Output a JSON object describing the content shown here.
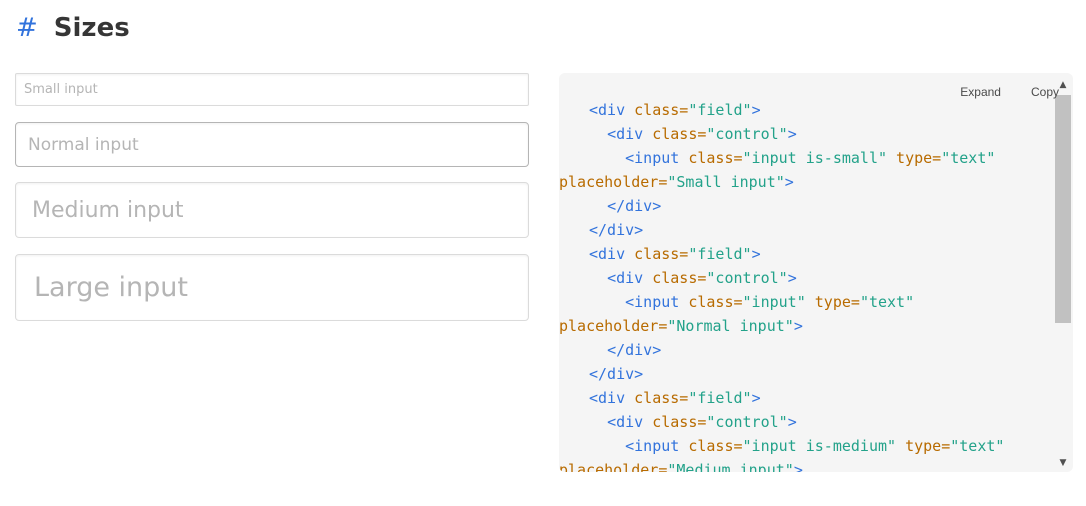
{
  "section": {
    "hash": "#",
    "title": "Sizes"
  },
  "inputs": {
    "small_placeholder": "Small input",
    "normal_placeholder": "Normal input",
    "medium_placeholder": "Medium input",
    "large_placeholder": "Large input"
  },
  "code_panel": {
    "expand_label": "Expand",
    "copy_label": "Copy",
    "lines": [
      {
        "indent": "",
        "parts": [
          [
            "tag",
            "<div "
          ],
          [
            "attr",
            "class="
          ],
          [
            "str",
            "\"field\""
          ],
          [
            "tag",
            ">"
          ]
        ]
      },
      {
        "indent": "  ",
        "parts": [
          [
            "tag",
            "<div "
          ],
          [
            "attr",
            "class="
          ],
          [
            "str",
            "\"control\""
          ],
          [
            "tag",
            ">"
          ]
        ]
      },
      {
        "indent": "    ",
        "parts": [
          [
            "tag",
            "<input "
          ],
          [
            "attr",
            "class="
          ],
          [
            "str",
            "\"input is-small\""
          ],
          [
            "attr",
            " type="
          ],
          [
            "str",
            "\"text\""
          ]
        ]
      },
      {
        "indent": "",
        "wrap": true,
        "parts": [
          [
            "attr",
            "placeholder="
          ],
          [
            "str",
            "\"Small input\""
          ],
          [
            "tag",
            ">"
          ]
        ]
      },
      {
        "indent": "  ",
        "parts": [
          [
            "tag",
            "</div>"
          ]
        ]
      },
      {
        "indent": "",
        "parts": [
          [
            "tag",
            "</div>"
          ]
        ]
      },
      {
        "indent": "",
        "parts": [
          [
            "tag",
            "<div "
          ],
          [
            "attr",
            "class="
          ],
          [
            "str",
            "\"field\""
          ],
          [
            "tag",
            ">"
          ]
        ]
      },
      {
        "indent": "  ",
        "parts": [
          [
            "tag",
            "<div "
          ],
          [
            "attr",
            "class="
          ],
          [
            "str",
            "\"control\""
          ],
          [
            "tag",
            ">"
          ]
        ]
      },
      {
        "indent": "    ",
        "parts": [
          [
            "tag",
            "<input "
          ],
          [
            "attr",
            "class="
          ],
          [
            "str",
            "\"input\""
          ],
          [
            "attr",
            " type="
          ],
          [
            "str",
            "\"text\""
          ]
        ]
      },
      {
        "indent": "",
        "wrap": true,
        "parts": [
          [
            "attr",
            "placeholder="
          ],
          [
            "str",
            "\"Normal input\""
          ],
          [
            "tag",
            ">"
          ]
        ]
      },
      {
        "indent": "  ",
        "parts": [
          [
            "tag",
            "</div>"
          ]
        ]
      },
      {
        "indent": "",
        "parts": [
          [
            "tag",
            "</div>"
          ]
        ]
      },
      {
        "indent": "",
        "parts": [
          [
            "tag",
            "<div "
          ],
          [
            "attr",
            "class="
          ],
          [
            "str",
            "\"field\""
          ],
          [
            "tag",
            ">"
          ]
        ]
      },
      {
        "indent": "  ",
        "parts": [
          [
            "tag",
            "<div "
          ],
          [
            "attr",
            "class="
          ],
          [
            "str",
            "\"control\""
          ],
          [
            "tag",
            ">"
          ]
        ]
      },
      {
        "indent": "    ",
        "parts": [
          [
            "tag",
            "<input "
          ],
          [
            "attr",
            "class="
          ],
          [
            "str",
            "\"input is-medium\""
          ],
          [
            "attr",
            " type="
          ],
          [
            "str",
            "\"text\""
          ]
        ]
      },
      {
        "indent": "",
        "wrap": true,
        "parts": [
          [
            "attr",
            "placeholder="
          ],
          [
            "str",
            "\"Medium input\""
          ],
          [
            "tag",
            ">"
          ]
        ]
      }
    ]
  },
  "icons": {
    "scroll_up": "scroll-up-arrow-icon",
    "scroll_down": "scroll-down-arrow-icon"
  },
  "colors": {
    "accent": "#3273dc",
    "code_tag": "#3273dc",
    "code_attr": "#b86b00",
    "code_string": "#23a28a"
  }
}
